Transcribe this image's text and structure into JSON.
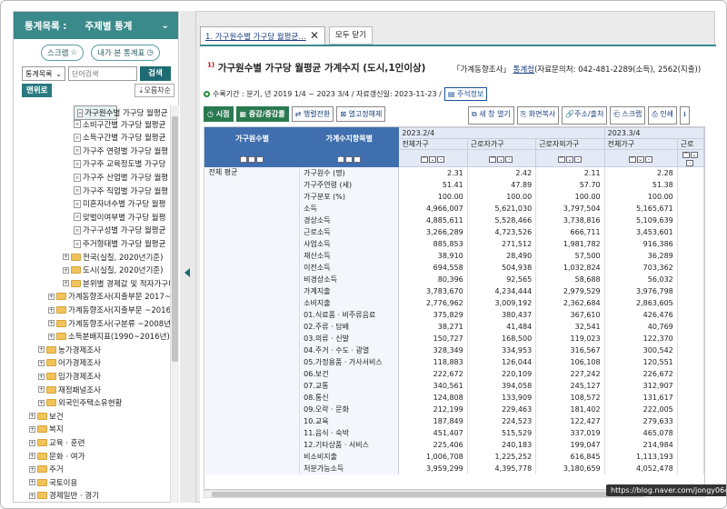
{
  "left": {
    "header": {
      "title": "통계목록 :",
      "subtitle": "주제별 통계"
    },
    "scrap_label": "스크랩",
    "recent_label": "내가 본 통계표",
    "search": {
      "select": "통계목록",
      "placeholder": "단어검색",
      "button": "검색"
    },
    "menu_label": "맨위로",
    "sort_label": "오름차순",
    "tree": [
      {
        "label": "가구원수별 가구당 월평균",
        "type": "doc",
        "indent": 66,
        "selected": true
      },
      {
        "label": "소비구간별 가구당 월평균",
        "type": "doc",
        "indent": 66
      },
      {
        "label": "소득구간별 가구당 월평균",
        "type": "doc",
        "indent": 66
      },
      {
        "label": "가구주 연령별 가구당 월평",
        "type": "doc",
        "indent": 66
      },
      {
        "label": "가구주 교육정도별 가구당",
        "type": "doc",
        "indent": 66
      },
      {
        "label": "가구주 산업별 가구당 월평",
        "type": "doc",
        "indent": 66
      },
      {
        "label": "가구주 직업별 가구당 월평",
        "type": "doc",
        "indent": 66
      },
      {
        "label": "미혼자녀수별 가구당 월평",
        "type": "doc",
        "indent": 66
      },
      {
        "label": "맞벌이여부별 가구당 월평",
        "type": "doc",
        "indent": 66
      },
      {
        "label": "가구구성별 가구당 월평균",
        "type": "doc",
        "indent": 66
      },
      {
        "label": "주거형태별 가구당 월평균",
        "type": "doc",
        "indent": 66
      },
      {
        "label": "전국(실질, 2020년기준)",
        "type": "folder",
        "indent": 54
      },
      {
        "label": "도시(실질, 2020년기준)",
        "type": "folder",
        "indent": 54
      },
      {
        "label": "분위별 경제값 및 적자가구비",
        "type": "folder",
        "indent": 54
      },
      {
        "label": "가계동향조사(지출부문 2017~20",
        "type": "folder",
        "indent": 38
      },
      {
        "label": "가계동향조사(지출부문 ~2016년",
        "type": "folder",
        "indent": 38
      },
      {
        "label": "가계동향조사(구분류 ~2008년)",
        "type": "folder",
        "indent": 38
      },
      {
        "label": "소득분배지표(1990~2016년)",
        "type": "folder",
        "indent": 38
      },
      {
        "label": "농가경제조사",
        "type": "folder",
        "indent": 27
      },
      {
        "label": "어가경제조사",
        "type": "folder",
        "indent": 27
      },
      {
        "label": "임가경제조사",
        "type": "folder",
        "indent": 27
      },
      {
        "label": "재정패널조사",
        "type": "folder",
        "indent": 27
      },
      {
        "label": "외국인주택소유현황",
        "type": "folder",
        "indent": 27
      },
      {
        "label": "보건",
        "type": "folder",
        "indent": 17
      },
      {
        "label": "복지",
        "type": "folder",
        "indent": 17
      },
      {
        "label": "교육 · 훈련",
        "type": "folder",
        "indent": 17
      },
      {
        "label": "문화 · 여가",
        "type": "folder",
        "indent": 17
      },
      {
        "label": "주거",
        "type": "folder",
        "indent": 17
      },
      {
        "label": "국토이용",
        "type": "folder",
        "indent": 17
      },
      {
        "label": "경제일반 · 경기",
        "type": "folder",
        "indent": 17
      }
    ]
  },
  "tabs": [
    {
      "label": "1. 가구원수별 가구당 월평균…"
    },
    {
      "label": "모두 닫기"
    }
  ],
  "content": {
    "title_num": "1)",
    "title": "가구원수별 가구당 월평균 가계수지 (도시,1인이상)",
    "source": "「가계동향조사」",
    "source_link": "통계청",
    "source_detail": "(자료문의처: 042-481-2289(소득), 2562(지출))",
    "period": "수록기간 : 분기, 년 2019 1/4 ~ 2023 3/4 / 자료갱신일: 2023-11-23 /",
    "note_btn": "주석정보",
    "toolbar": [
      "시점",
      "증감/증감률",
      "행렬전환",
      "열고정해제"
    ],
    "toolbar2": [
      "새 창 열기",
      "화면복사",
      "주소/출처",
      "스크랩",
      "인쇄"
    ],
    "table": {
      "col_head1": "가구원수별",
      "col_head2": "가계수지항목별",
      "period1": "2023.2/4",
      "period2": "2023.3/4",
      "sub_cols": [
        "전체가구",
        "근로자가구",
        "근로자외가구",
        "전체가구",
        "근로"
      ],
      "group": "전체 평균",
      "rows": [
        {
          "label": "가구원수 (명)",
          "v": [
            "2.31",
            "2.42",
            "2.11",
            "2.28"
          ]
        },
        {
          "label": "가구주연령 (세)",
          "v": [
            "51.41",
            "47.89",
            "57.70",
            "51.38"
          ]
        },
        {
          "label": "가구분포 (%)",
          "v": [
            "100.00",
            "100.00",
            "100.00",
            "100.00"
          ]
        },
        {
          "label": "소득",
          "v": [
            "4,966,007",
            "5,621,030",
            "3,797,504",
            "5,165,671"
          ]
        },
        {
          "label": "경상소득",
          "v": [
            "4,885,611",
            "5,528,466",
            "3,738,816",
            "5,109,639"
          ]
        },
        {
          "label": "근로소득",
          "v": [
            "3,266,289",
            "4,723,526",
            "666,711",
            "3,453,601"
          ]
        },
        {
          "label": "사업소득",
          "v": [
            "885,853",
            "271,512",
            "1,981,782",
            "916,386"
          ]
        },
        {
          "label": "재산소득",
          "v": [
            "38,910",
            "28,490",
            "57,500",
            "36,289"
          ]
        },
        {
          "label": "이전소득",
          "v": [
            "694,558",
            "504,938",
            "1,032,824",
            "703,362"
          ]
        },
        {
          "label": "비경상소득",
          "v": [
            "80,396",
            "92,565",
            "58,688",
            "56,032"
          ]
        },
        {
          "label": "가계지출",
          "v": [
            "3,783,670",
            "4,234,444",
            "2,979,529",
            "3,976,798"
          ]
        },
        {
          "label": "소비지출",
          "v": [
            "2,776,962",
            "3,009,192",
            "2,362,684",
            "2,863,605"
          ]
        },
        {
          "label": "01.식료품 · 비주류음료",
          "v": [
            "375,829",
            "380,437",
            "367,610",
            "426,476"
          ]
        },
        {
          "label": "02.주류 · 담배",
          "v": [
            "38,271",
            "41,484",
            "32,541",
            "40,769"
          ]
        },
        {
          "label": "03.의류 · 신발",
          "v": [
            "150,727",
            "168,500",
            "119,023",
            "122,370"
          ]
        },
        {
          "label": "04.주거 · 수도 · 광열",
          "v": [
            "328,349",
            "334,953",
            "316,567",
            "300,542"
          ]
        },
        {
          "label": "05.가정용품 · 가사서비스",
          "v": [
            "118,883",
            "126,044",
            "106,108",
            "120,551"
          ]
        },
        {
          "label": "06.보건",
          "v": [
            "222,672",
            "220,109",
            "227,242",
            "226,672"
          ]
        },
        {
          "label": "07.교통",
          "v": [
            "340,561",
            "394,058",
            "245,127",
            "312,907"
          ]
        },
        {
          "label": "08.통신",
          "v": [
            "124,808",
            "133,909",
            "108,572",
            "131,617"
          ]
        },
        {
          "label": "09.오락 · 문화",
          "v": [
            "212,199",
            "229,463",
            "181,402",
            "222,005"
          ]
        },
        {
          "label": "10.교육",
          "v": [
            "187,849",
            "224,523",
            "122,427",
            "279,633"
          ]
        },
        {
          "label": "11.음식 · 숙박",
          "v": [
            "451,407",
            "515,529",
            "337,019",
            "465,078"
          ]
        },
        {
          "label": "12.기타상품 · 서비스",
          "v": [
            "225,406",
            "240,183",
            "199,047",
            "214,984"
          ]
        },
        {
          "label": "비소비지출",
          "v": [
            "1,006,708",
            "1,225,252",
            "616,845",
            "1,113,193"
          ]
        },
        {
          "label": "처분가능소득",
          "v": [
            "3,959,299",
            "4,395,778",
            "3,180,659",
            "4,052,478"
          ]
        }
      ]
    }
  },
  "watermark": "https://blog.naver.com/jongy0644"
}
